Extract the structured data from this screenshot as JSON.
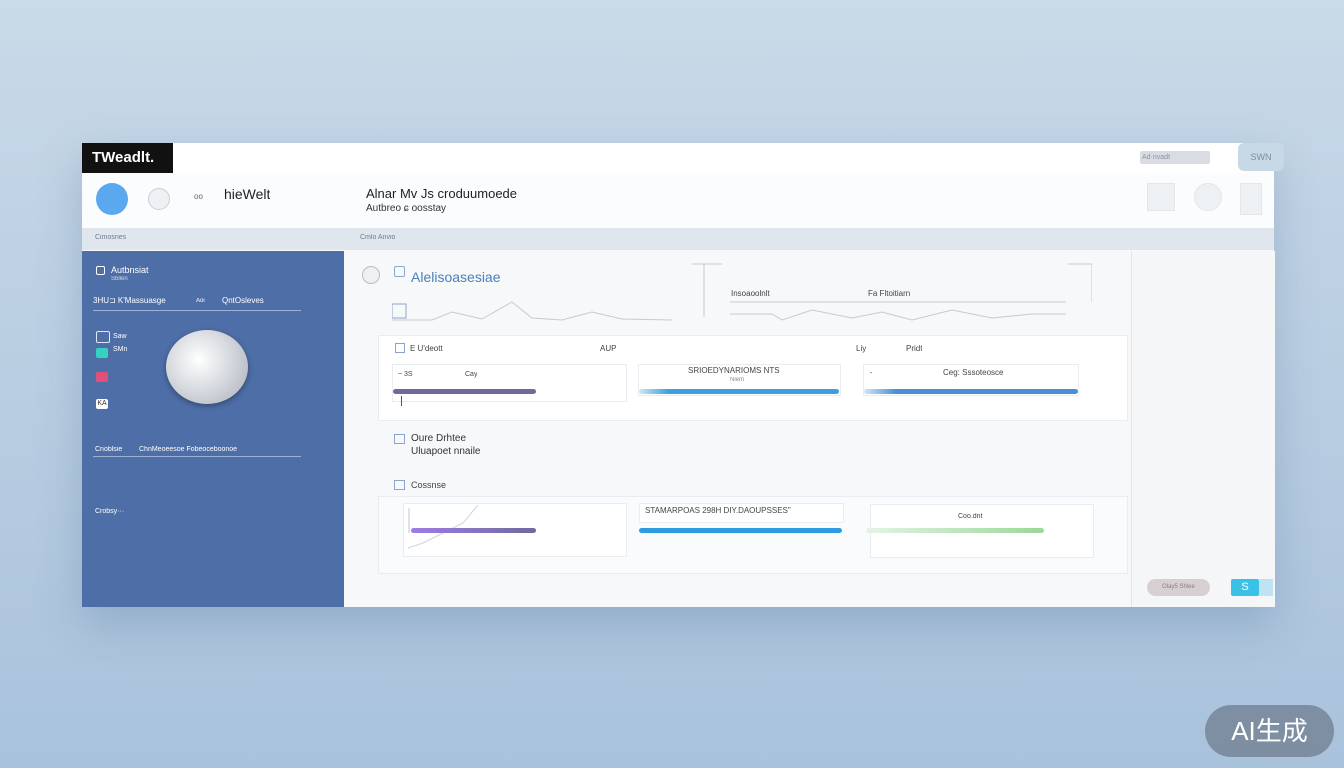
{
  "app": {
    "logo": "TWeadlt.",
    "topbar_right": "Ad·nvadt",
    "topbar_far": "SWN"
  },
  "header": {
    "dot_label": "oo",
    "title": "hieWelt",
    "main_title": "Alnar  Mv Js croduumoede",
    "main_subtitle": "Autbreo ɕ oosstay"
  },
  "strip": {
    "left": "Cimosnes",
    "right": "Cmlo Anvio"
  },
  "sidebar": {
    "section_title": "Autbnsiat",
    "section_sub": "Sbllen",
    "row_left": "3HU⊐  K'Massuasge",
    "row_mid": "Aoi",
    "row_right": "QntOsleves",
    "check_items": [
      "Saw",
      "SMn",
      "",
      "KA"
    ],
    "bottom_left": "Cnoblsie",
    "bottom_right": "ChnMeoeesoe Fobeoceboonoe",
    "footer": "Crobsy···"
  },
  "main": {
    "section1_title": "Alelisoasesiae",
    "chart_label_left": "Insoaoolnlt",
    "chart_label_right": "Fa  Fltoitiarn",
    "row1": {
      "col1": "E U'deott",
      "col2": "AUP",
      "col3": "Liy",
      "col4": "Pridt"
    },
    "card1_a": "~ 3S",
    "card1_b": "Cay",
    "card2_title": "SRIOEDYNARIOMS NTS",
    "card2_sub": "Nlem",
    "card3_text": "Ceg: Sssoteosce",
    "section2_title": "Oure Drhtee",
    "section2_sub": "Uluapoet nnaile",
    "section3_title": "Cossnse",
    "card4_title": "STAMARPOAS 298H DIY.DAOUPSSES\"",
    "card5_text": "Coo.dnt"
  },
  "footer": {
    "pill_label": "Olay5 Shlee",
    "icon_label": "S"
  },
  "watermark": "AI生成",
  "colors": {
    "sidebar": "#4e6ea8",
    "accent_blue": "#3aa0e0",
    "accent_purple": "#6f6a9c",
    "accent_green": "#9ad89a"
  }
}
